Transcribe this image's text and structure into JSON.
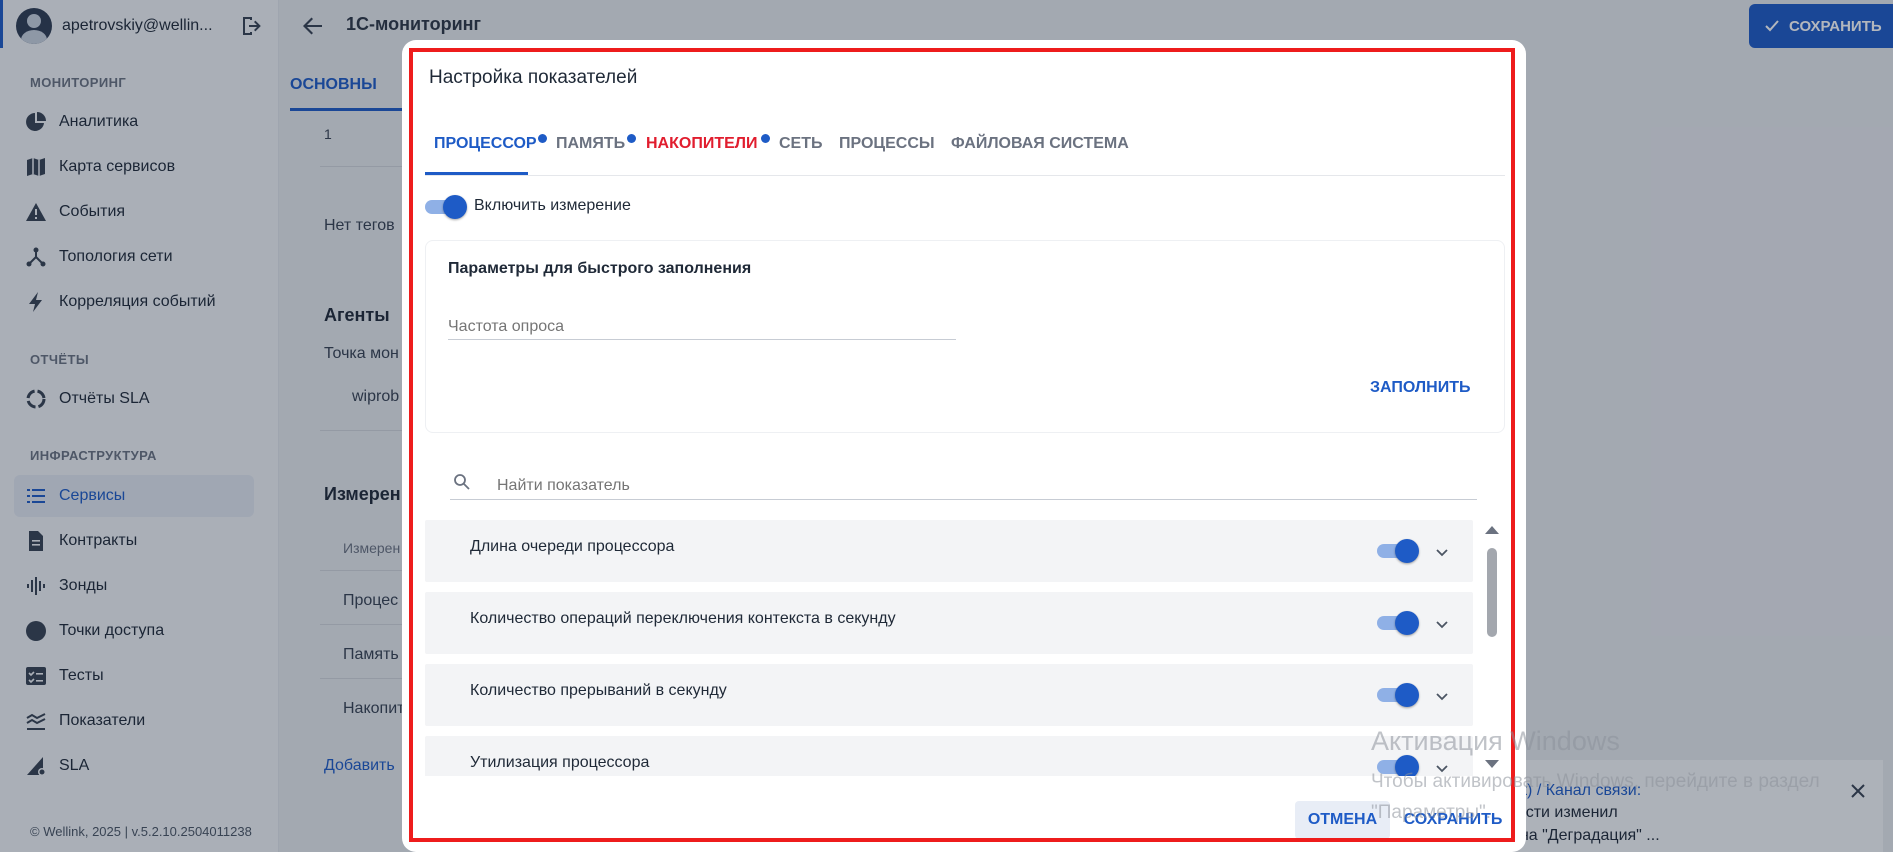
{
  "sidebar": {
    "user": "apetrovskiy@wellin...",
    "sections": {
      "monitoring": "МОНИТОРИНГ",
      "reports": "ОТЧЁТЫ",
      "infrastructure": "ИНФРАСТРУКТУРА"
    },
    "items": {
      "analytics": "Аналитика",
      "service_map": "Карта сервисов",
      "events": "События",
      "topology": "Топология сети",
      "correlation": "Корреляция событий",
      "sla_reports": "Отчёты SLA",
      "services": "Сервисы",
      "contracts": "Контракты",
      "probes": "Зонды",
      "access_points": "Точки доступа",
      "tests": "Тесты",
      "metrics": "Показатели",
      "sla": "SLA"
    },
    "footer": "© Wellink, 2025 | v.5.2.10.2504011238"
  },
  "header": {
    "title": "1С-мониторинг",
    "save_label": "СОХРАНИТЬ"
  },
  "background": {
    "main_tab": "ОСНОВНЫ",
    "value_1": "1",
    "no_tags": "Нет тегов",
    "agents_heading": "Агенты",
    "monitoring_point": "Точка мон",
    "probe_name": "wiprob",
    "measurements_heading": "Измерен",
    "col_header": "Измерен",
    "row_cpu": "Процес",
    "row_memory": "Память",
    "row_storage": "Накопит",
    "add_link": "Добавить"
  },
  "notification": {
    "line1": "с Viktor (U-Test) / Канал связи:",
    "line2": "от неисправности изменил",
    "line3": "ень с \"Отказ\" на \"Деградация\" ..."
  },
  "modal": {
    "title": "Настройка показателей",
    "tabs": {
      "cpu": "ПРОЦЕССОР",
      "memory": "ПАМЯТЬ",
      "storage": "НАКОПИТЕЛИ",
      "network": "СЕТЬ",
      "processes": "ПРОЦЕССЫ",
      "filesystem": "ФАЙЛОВАЯ СИСТЕМА"
    },
    "enable_label": "Включить измерение",
    "quick_fill_title": "Параметры для быстрого заполнения",
    "poll_frequency_placeholder": "Частота опроса",
    "fill_label": "ЗАПОЛНИТЬ",
    "search_placeholder": "Найти показатель",
    "metrics": {
      "cpu_queue": "Длина очереди процессора",
      "context_switches": "Количество операций переключения контекста в секунду",
      "interrupts": "Количество прерываний в секунду",
      "cpu_utilization": "Утилизация процессора"
    },
    "cancel_label": "ОТМЕНА",
    "save_label": "СОХРАНИТЬ"
  },
  "watermark": {
    "title": "Активация Windows",
    "subtitle": "Чтобы активировать Windows, перейдите в раздел \"Параметры\"."
  },
  "colors": {
    "accent": "#1e5bc6",
    "error": "#e11d2e",
    "highlight_frame": "#ee1c1c"
  }
}
